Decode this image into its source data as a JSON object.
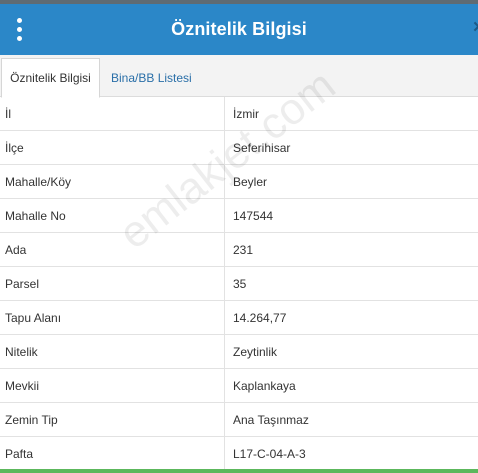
{
  "header": {
    "title": "Öznitelik Bilgisi",
    "close_glyph": "×"
  },
  "tabs": [
    {
      "label": "Öznitelik Bilgisi",
      "active": true
    },
    {
      "label": "Bina/BB Listesi",
      "active": false
    }
  ],
  "rows": [
    {
      "label": "İl",
      "value": "İzmir"
    },
    {
      "label": "İlçe",
      "value": "Seferihisar"
    },
    {
      "label": "Mahalle/Köy",
      "value": "Beyler"
    },
    {
      "label": "Mahalle No",
      "value": "147544"
    },
    {
      "label": "Ada",
      "value": "231"
    },
    {
      "label": "Parsel",
      "value": "35"
    },
    {
      "label": "Tapu Alanı",
      "value": "14.264,77"
    },
    {
      "label": "Nitelik",
      "value": "Zeytinlik"
    },
    {
      "label": "Mevkii",
      "value": "Kaplankaya"
    },
    {
      "label": "Zemin Tip",
      "value": "Ana Taşınmaz"
    },
    {
      "label": "Pafta",
      "value": "L17-C-04-A-3"
    }
  ],
  "watermark": "emlakjet.com",
  "colors": {
    "header": "#2b87c8",
    "tab_link": "#2a6fa8",
    "accent_bottom": "#5cb85c"
  }
}
